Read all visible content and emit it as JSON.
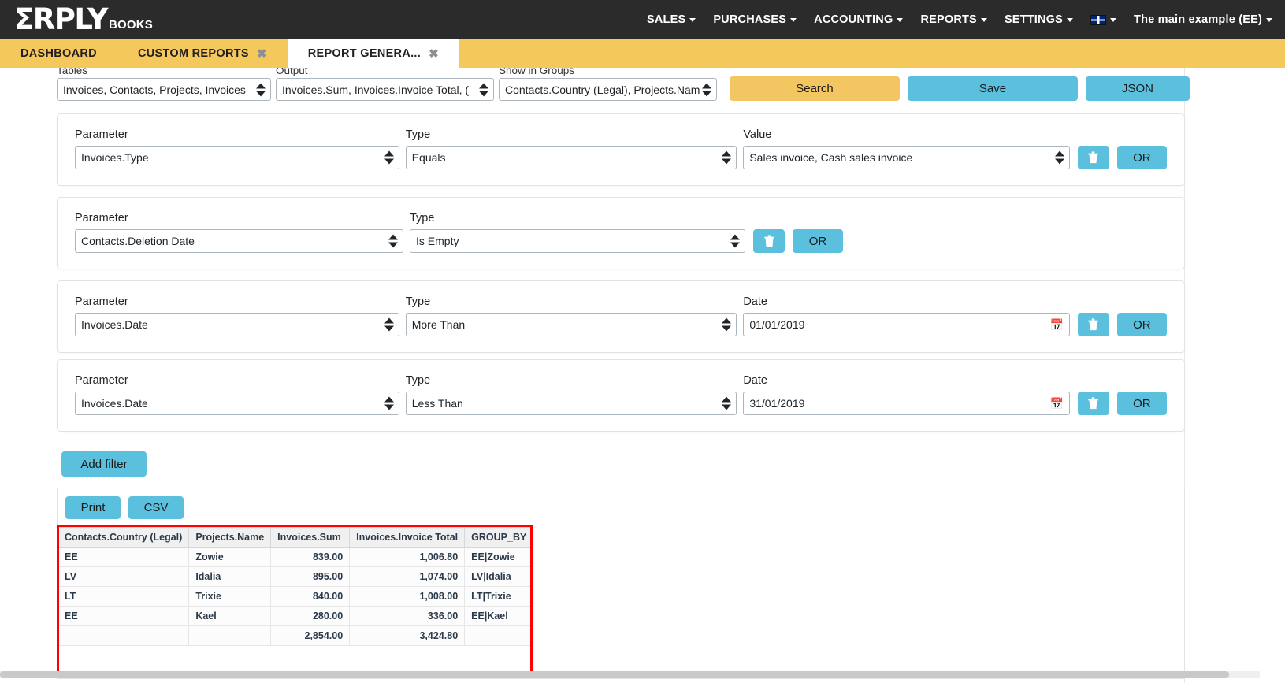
{
  "brand": {
    "mark": "ΣRPLY",
    "sub": "BOOKS"
  },
  "topnav": {
    "items": [
      {
        "label": "SALES",
        "icon": "chevron-down-icon"
      },
      {
        "label": "PURCHASES",
        "icon": "chevron-down-icon"
      },
      {
        "label": "ACCOUNTING",
        "icon": "chevron-down-icon"
      },
      {
        "label": "REPORTS",
        "icon": "chevron-down-icon"
      },
      {
        "label": "SETTINGS",
        "icon": "chevron-down-icon"
      }
    ],
    "language": {
      "icon": "uk-flag-icon",
      "label": ""
    },
    "account": "The main example (EE)"
  },
  "tabs": [
    {
      "label": "DASHBOARD",
      "active": false,
      "closable": false
    },
    {
      "label": "CUSTOM REPORTS",
      "active": false,
      "closable": true,
      "close": "✖"
    },
    {
      "label": "REPORT GENERA...",
      "active": true,
      "closable": true,
      "close": "✖"
    }
  ],
  "controls": {
    "tables": {
      "label": "Tables",
      "value": "Invoices, Contacts, Projects, Invoices"
    },
    "output": {
      "label": "Output",
      "value": "Invoices.Sum, Invoices.Invoice Total, ("
    },
    "groups": {
      "label": "Show in Groups",
      "value": "Contacts.Country (Legal), Projects.Nam"
    },
    "search_label": "Search",
    "save_label": "Save",
    "json_label": "JSON"
  },
  "labels": {
    "parameter": "Parameter",
    "type": "Type",
    "value": "Value",
    "date": "Date",
    "or": "OR",
    "delete_icon": "trash-icon",
    "calendar_icon": "calendar-icon"
  },
  "filters": [
    {
      "parameter": "Invoices.Type",
      "type": "Equals",
      "third_label": "Value",
      "third_kind": "select",
      "third_value": "Sales invoice, Cash sales invoice"
    },
    {
      "parameter": "Contacts.Deletion Date",
      "type": "Is Empty",
      "third_label": "",
      "third_kind": "none",
      "third_value": ""
    },
    {
      "parameter": "Invoices.Date",
      "type": "More Than",
      "third_label": "Date",
      "third_kind": "date",
      "third_value": "01/01/2019"
    },
    {
      "parameter": "Invoices.Date",
      "type": "Less Than",
      "third_label": "Date",
      "third_kind": "date",
      "third_value": "31/01/2019"
    }
  ],
  "add_filter_label": "Add filter",
  "results_tools": {
    "print": "Print",
    "csv": "CSV"
  },
  "results": {
    "columns": [
      "Contacts.Country (Legal)",
      "Projects.Name",
      "Invoices.Sum",
      "Invoices.Invoice Total",
      "GROUP_BY"
    ],
    "rows": [
      [
        "EE",
        "Zowie",
        "839.00",
        "1,006.80",
        "EE|Zowie"
      ],
      [
        "LV",
        "Idalia",
        "895.00",
        "1,074.00",
        "LV|Idalia"
      ],
      [
        "LT",
        "Trixie",
        "840.00",
        "1,008.00",
        "LT|Trixie"
      ],
      [
        "EE",
        "Kael",
        "280.00",
        "336.00",
        "EE|Kael"
      ]
    ],
    "total": [
      "",
      "",
      "2,854.00",
      "3,424.80",
      ""
    ]
  },
  "colors": {
    "nav_bg": "#2b2b2b",
    "tab_bg": "#f5c85c",
    "accent_blue": "#5bc0de",
    "accent_yellow": "#f3c662",
    "highlight_red": "#ff0000"
  }
}
